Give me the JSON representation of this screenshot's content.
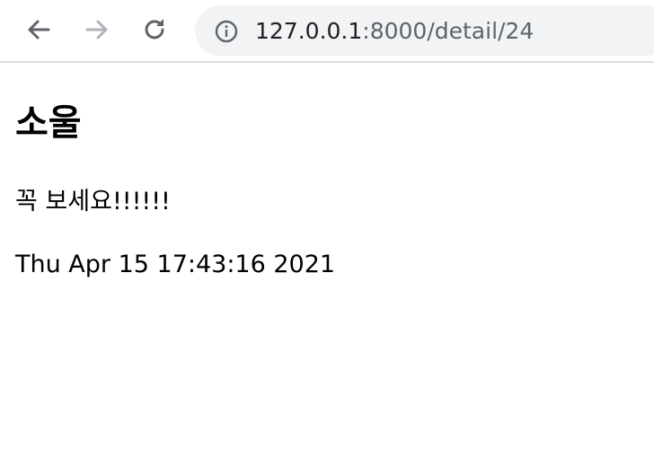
{
  "browser": {
    "url_host": "127.0.0.1",
    "url_path": ":8000/detail/24",
    "icons": {
      "back": "arrow-left-icon",
      "forward": "arrow-right-icon",
      "reload": "reload-icon",
      "site_info": "info-icon"
    },
    "colors": {
      "icon_active": "#5f6368",
      "icon_disabled": "#b0b3b8",
      "omnibox_bg": "#f1f3f4"
    }
  },
  "page": {
    "title": "소울",
    "message": "꼭 보세요!!!!!!",
    "timestamp": "Thu Apr 15 17:43:16 2021"
  }
}
